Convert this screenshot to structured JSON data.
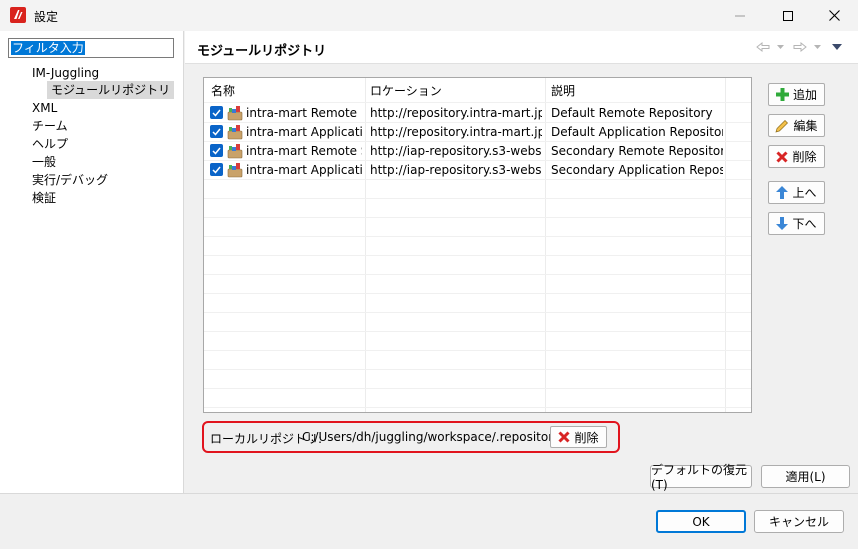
{
  "window": {
    "title": "設定"
  },
  "sidebar": {
    "filter_text": "フィルタ入力",
    "items": [
      {
        "label": "IM-Juggling"
      },
      {
        "label": "モジュールリポジトリ",
        "selected": true
      },
      {
        "label": "XML"
      },
      {
        "label": "チーム"
      },
      {
        "label": "ヘルプ"
      },
      {
        "label": "一般"
      },
      {
        "label": "実行/デバッグ"
      },
      {
        "label": "検証"
      }
    ]
  },
  "page": {
    "title": "モジュールリポジトリ"
  },
  "table": {
    "columns": [
      "名称",
      "ロケーション",
      "説明"
    ],
    "rows": [
      {
        "checked": true,
        "name": "intra-mart Remote R...",
        "location": "http://repository.intra-mart.jp...",
        "description": "Default Remote Repository"
      },
      {
        "checked": true,
        "name": "intra-mart Applicati...",
        "location": "http://repository.intra-mart.jp...",
        "description": "Default Application Repository"
      },
      {
        "checked": true,
        "name": "intra-mart Remote S...",
        "location": "http://iap-repository.s3-websi...",
        "description": "Secondary Remote Repository"
      },
      {
        "checked": true,
        "name": "intra-mart Applicati...",
        "location": "http://iap-repository.s3-websi...",
        "description": "Secondary Application Reposi..."
      }
    ]
  },
  "side_buttons": {
    "add": "追加",
    "edit": "編集",
    "delete": "削除",
    "up": "上へ",
    "down": "下へ"
  },
  "local_repository": {
    "label": "ローカルリポジトリ:",
    "path": "C:/Users/dh/juggling/workspace/.repository/",
    "delete_label": "削除"
  },
  "page_buttons": {
    "restore_defaults": "デフォルトの復元(T)",
    "apply": "適用(L)"
  },
  "dialog_buttons": {
    "ok": "OK",
    "cancel": "キャンセル"
  },
  "colors": {
    "accent": "#0078d7",
    "highlight_border": "#e1141e",
    "checkbox": "#0a64c8"
  }
}
